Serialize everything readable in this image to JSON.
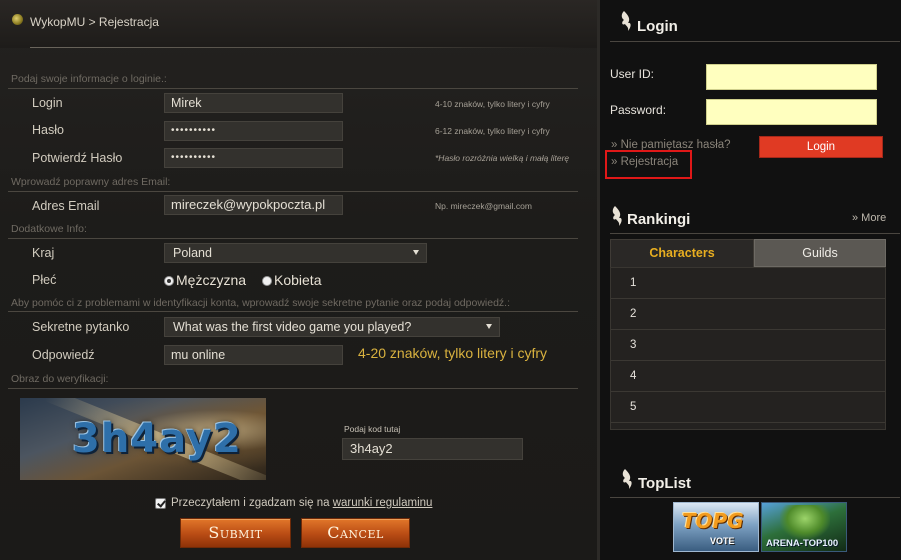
{
  "breadcrumb": "WykopMU > Rejestracja",
  "sections": {
    "login_info": "Podaj swoje informacje o loginie.:",
    "email": "Wprowadź poprawny adres Email:",
    "additional": "Dodatkowe Info:",
    "secret_intro": "Aby pomóc ci z problemami w identyfikacji konta, wprowadź swoje sekretne pytanie oraz podaj odpowiedź.:",
    "captcha": "Obraz do weryfikacji:"
  },
  "form": {
    "login": {
      "label": "Login",
      "value": "Mirek",
      "hint": "4-10 znaków, tylko litery i cyfry"
    },
    "password": {
      "label": "Hasło",
      "value": "••••••••••",
      "hint": "6-12 znaków, tylko litery i cyfry"
    },
    "confirm": {
      "label": "Potwierdź Hasło",
      "value": "••••••••••",
      "hint": "*Hasło rozróżnia wielką i małą literę"
    },
    "email": {
      "label": "Adres Email",
      "value": "mireczek@wypokpoczta.pl",
      "hint": "Np. mireczek@gmail.com"
    },
    "country": {
      "label": "Kraj",
      "value": "Poland"
    },
    "gender": {
      "label": "Płeć",
      "options": [
        "Mężczyzna",
        "Kobieta"
      ],
      "selected": "Mężczyzna"
    },
    "question": {
      "label": "Sekretne pytanko",
      "value": "What was the first video game you played?"
    },
    "answer": {
      "label": "Odpowiedź",
      "value": "mu online",
      "hint": "4-20 znaków, tylko litery i cyfry"
    },
    "captcha": {
      "image_text": "3h4ay2",
      "code_label": "Podaj kod tutaj",
      "code_value": "3h4ay2"
    },
    "terms": {
      "prefix": "Przeczytałem i zgadzam się na",
      "link": "warunki regulaminu",
      "checked": true
    },
    "submit": "Submit",
    "cancel": "Cancel"
  },
  "sidebar": {
    "login": {
      "title": "Login",
      "user_label": "User ID:",
      "password_label": "Password:",
      "forgot": "» Nie pamiętasz hasła?",
      "register": "» Rejestracja",
      "button": "Login"
    },
    "rankings": {
      "title": "Rankingi",
      "more": "» More",
      "tabs": [
        "Characters",
        "Guilds"
      ],
      "active_tab": "Characters",
      "rows": [
        "1",
        "2",
        "3",
        "4",
        "5"
      ]
    },
    "toplist": {
      "title": "TopList",
      "banners": [
        {
          "big": "TOPG",
          "small": "VOTE"
        },
        {
          "small": "ARENA-TOP100"
        }
      ]
    }
  },
  "colors": {
    "accent_gold": "#d9b23f",
    "tab_active": "#e8ae20",
    "login_button": "#e03a23",
    "input_yellow": "#ffffbf",
    "highlight_box": "#e01818"
  }
}
